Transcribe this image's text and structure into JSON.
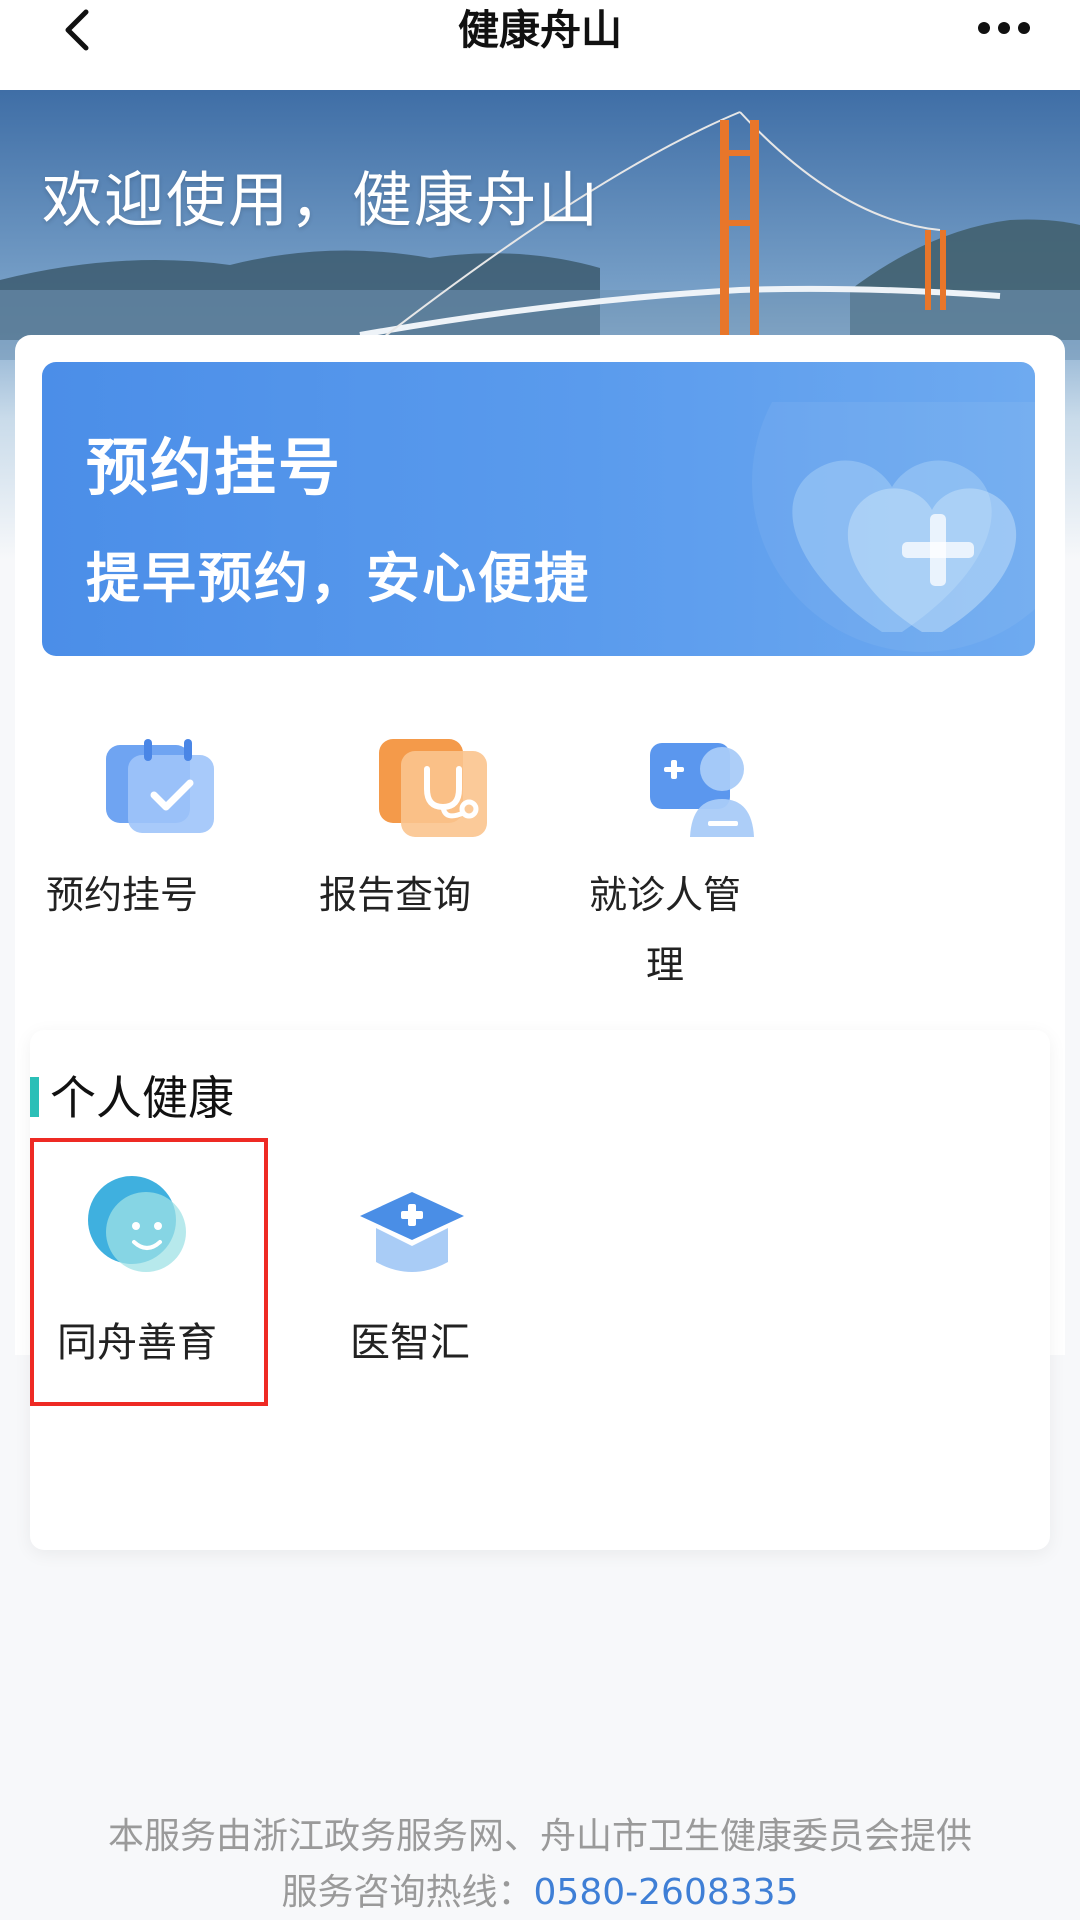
{
  "nav": {
    "back_icon": "chevron-left-icon",
    "title": "健康舟山",
    "more_icon": "more-dots-icon"
  },
  "banner": {
    "welcome": "欢迎使用，健康舟山"
  },
  "appointment_card": {
    "title": "预约挂号",
    "subtitle": "提早预约，安心便捷",
    "color": "#4b8ee8"
  },
  "services": [
    {
      "label": "预约挂号",
      "icon": "calendar-check-icon"
    },
    {
      "label": "报告查询",
      "icon": "stethoscope-icon"
    },
    {
      "label_line1": "就诊人管",
      "label_line2": "理",
      "icon": "patient-manage-icon"
    }
  ],
  "personal_health": {
    "title": "个人健康",
    "accent": "#2bbfb7",
    "items": [
      {
        "label": "同舟善育",
        "icon": "smiley-face-icon",
        "highlighted": true
      },
      {
        "label": "医智汇",
        "icon": "graduation-cap-icon",
        "highlighted": false
      }
    ]
  },
  "footer": {
    "provider": "本服务由浙江政务服务网、舟山市卫生健康委员会提供",
    "hotline_label": "服务咨询热线：",
    "hotline_number": "0580-2608335"
  },
  "highlight_color": "#ee2a24"
}
